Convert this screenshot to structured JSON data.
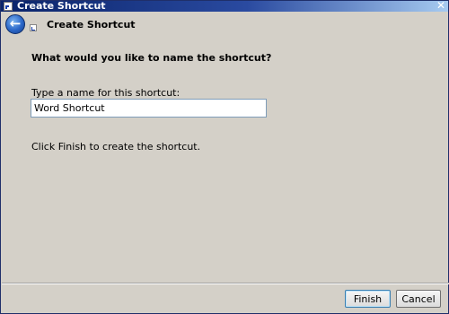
{
  "window": {
    "title": "Create Shortcut",
    "close_glyph": "✕"
  },
  "header": {
    "back_glyph": "←",
    "title": "Create Shortcut"
  },
  "content": {
    "question": "What would you like to name the shortcut?",
    "name_label": "Type a name for this shortcut:",
    "name_value": "Word Shortcut",
    "finish_note": "Click Finish to create the shortcut."
  },
  "footer": {
    "finish_label": "Finish",
    "cancel_label": "Cancel"
  },
  "colors": {
    "titlebar_start": "#0a246a",
    "titlebar_end": "#a6caf0",
    "dialog_bg": "#d4d0c8",
    "back_button": "#2a66c8"
  },
  "icons": [
    "shortcut-icon",
    "back-arrow-icon",
    "close-icon"
  ]
}
